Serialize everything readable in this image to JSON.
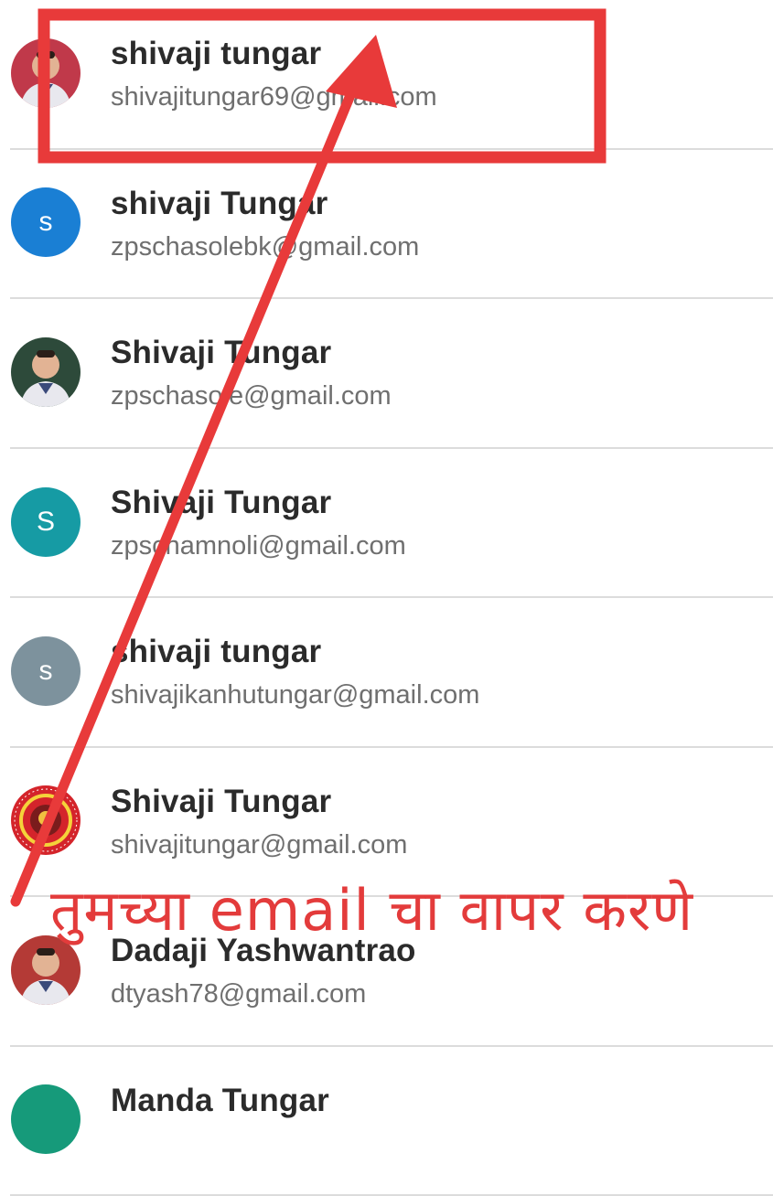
{
  "accounts": [
    {
      "name": "shivaji tungar",
      "email": "shivajitungar69@gmail.com",
      "avatar": {
        "type": "photo",
        "color": "#c0394a",
        "icon": "person-photo-icon"
      }
    },
    {
      "name": "shivaji Tungar",
      "email": "zpschasolebk@gmail.com",
      "avatar": {
        "type": "initial",
        "letter": "s",
        "color": "#1a7fd4"
      }
    },
    {
      "name": "Shivaji Tungar",
      "email": "zpschasole@gmail.com",
      "avatar": {
        "type": "photo",
        "color": "#2d4a3a",
        "icon": "person-photo-icon"
      }
    },
    {
      "name": "Shivaji Tungar",
      "email": "zpschamnoli@gmail.com",
      "avatar": {
        "type": "initial",
        "letter": "S",
        "color": "#169ba4"
      }
    },
    {
      "name": "shivaji tungar",
      "email": "shivajikanhutungar@gmail.com",
      "avatar": {
        "type": "initial",
        "letter": "s",
        "color": "#7d929d"
      }
    },
    {
      "name": "Shivaji Tungar",
      "email": "shivajitungar@gmail.com",
      "avatar": {
        "type": "logo",
        "color": "#d4242b",
        "icon": "emblem-logo-icon"
      }
    },
    {
      "name": "Dadaji Yashwantrao",
      "email": "dtyash78@gmail.com",
      "avatar": {
        "type": "photo",
        "color": "#b43a36",
        "icon": "person-photo-icon"
      }
    },
    {
      "name": "Manda Tungar",
      "email": "",
      "avatar": {
        "type": "initial",
        "letter": "",
        "color": "#169a7a"
      }
    }
  ],
  "annotation": {
    "text": "तुमच्या email  चा वापर करणे",
    "color": "#e33b3b"
  }
}
